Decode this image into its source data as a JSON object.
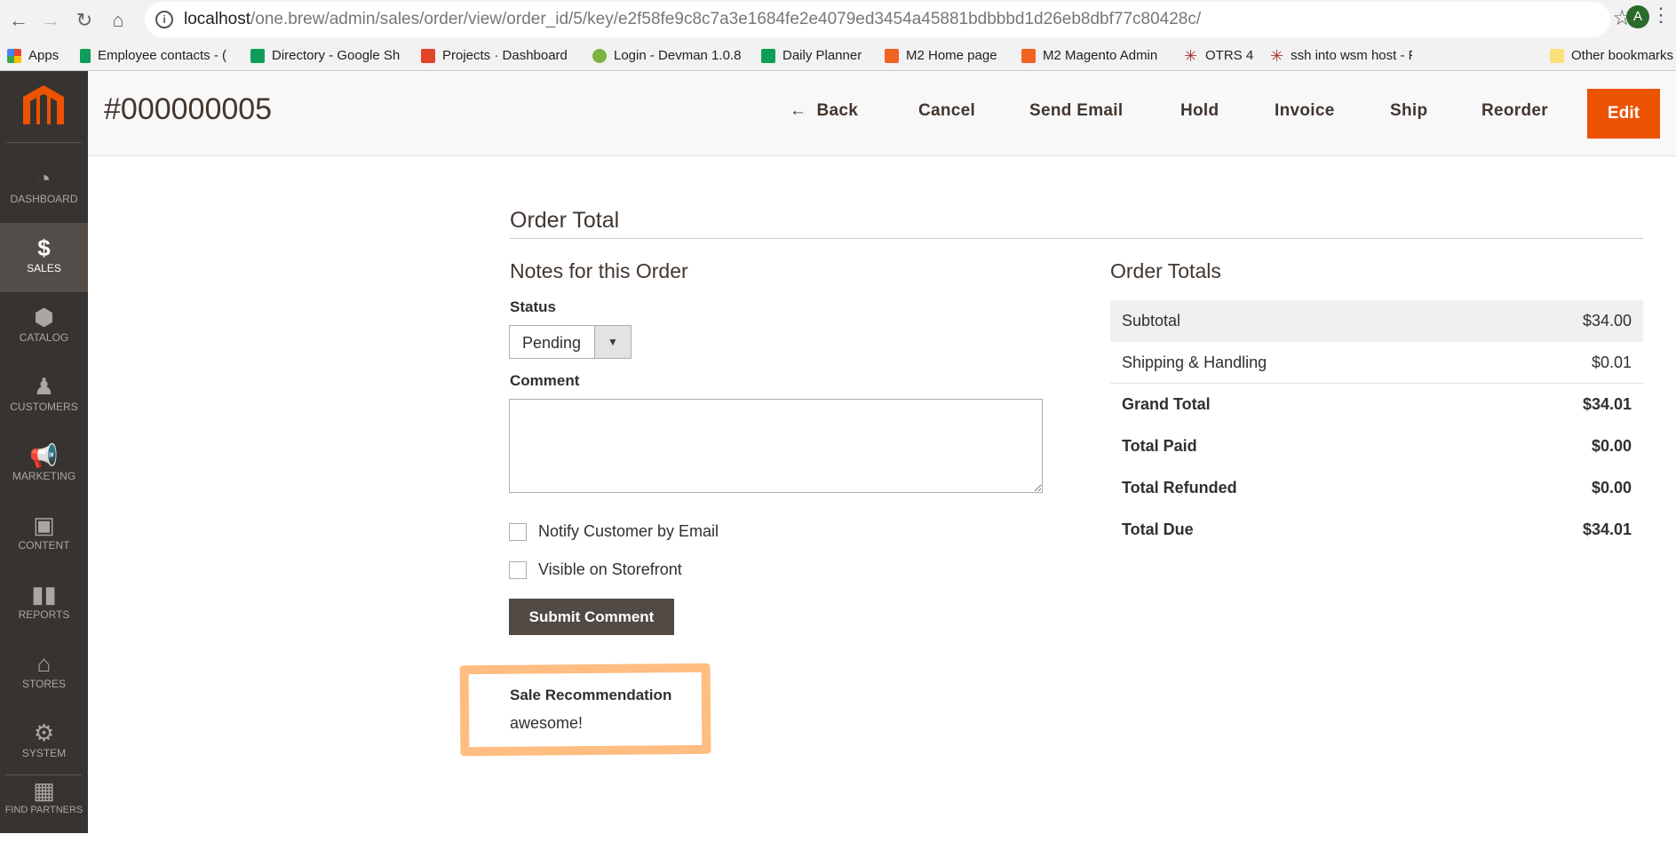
{
  "browser": {
    "url_host": "localhost",
    "url_path": "/one.brew/admin/sales/order/view/order_id/5/key/e2f58fe9c8c7a3e1684fe2e4079ed3454a45881bdbbbd1d26eb8dbf77c80428c/",
    "profile_initial": "A",
    "bookmarks": [
      "Apps",
      "Employee contacts - (",
      "Directory - Google Sh",
      "Projects · Dashboard",
      "Login - Devman 1.0.8",
      "Daily Planner",
      "M2 Home page",
      "M2 Magento Admin",
      "OTRS 4",
      "ssh into wsm host - F",
      "Other bookmarks"
    ]
  },
  "sidebar": {
    "items": [
      "DASHBOARD",
      "SALES",
      "CATALOG",
      "CUSTOMERS",
      "MARKETING",
      "CONTENT",
      "REPORTS",
      "STORES",
      "SYSTEM",
      "FIND PARTNERS"
    ],
    "active": "SALES"
  },
  "header": {
    "title": "#000000005",
    "buttons": [
      "Back",
      "Cancel",
      "Send Email",
      "Hold",
      "Invoice",
      "Ship",
      "Reorder"
    ],
    "edit": "Edit",
    "accent": "#eb5202"
  },
  "section_title": "Order Total",
  "notes": {
    "heading": "Notes for this Order",
    "status_label": "Status",
    "status_value": "Pending",
    "comment_label": "Comment",
    "notify": "Notify Customer by Email",
    "visible": "Visible on Storefront",
    "submit": "Submit Comment",
    "rec_label": "Sale Recommendation",
    "rec_value": "awesome!"
  },
  "totals": {
    "heading": "Order Totals",
    "rows": [
      {
        "label": "Subtotal",
        "value": "$34.00"
      },
      {
        "label": "Shipping & Handling",
        "value": "$0.01"
      },
      {
        "label": "Grand Total",
        "value": "$34.01"
      },
      {
        "label": "Total Paid",
        "value": "$0.00"
      },
      {
        "label": "Total Refunded",
        "value": "$0.00"
      },
      {
        "label": "Total Due",
        "value": "$34.01"
      }
    ]
  }
}
